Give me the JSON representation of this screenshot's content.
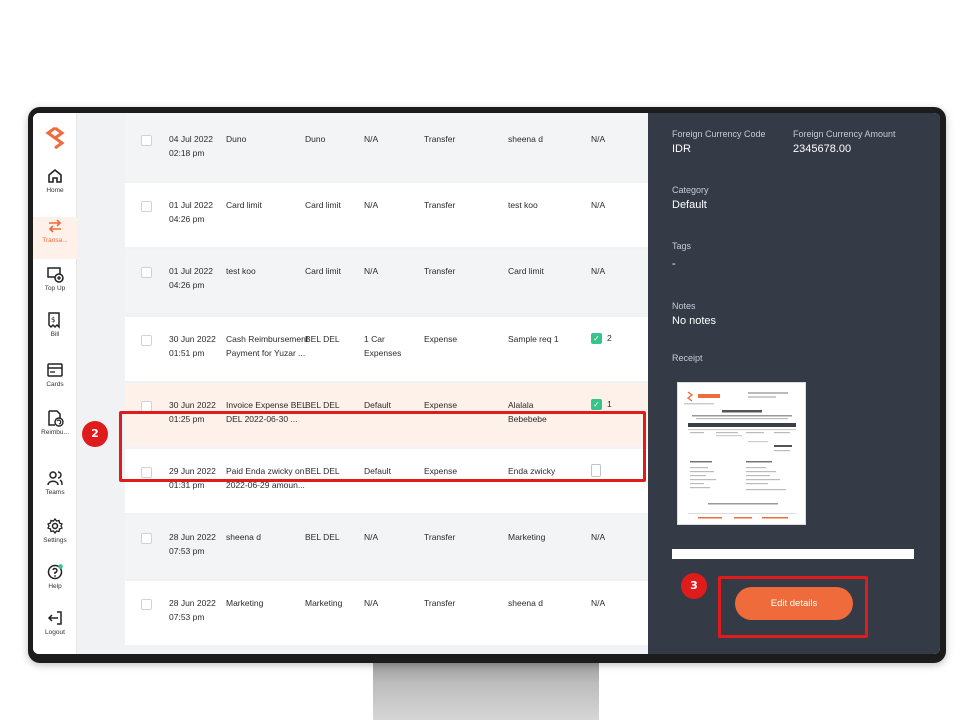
{
  "sidebar": {
    "items": [
      {
        "label": "Home",
        "icon": "home-icon"
      },
      {
        "label": "Transa...",
        "icon": "transfer-icon"
      },
      {
        "label": "Top Up",
        "icon": "top-up-icon"
      },
      {
        "label": "Bill",
        "icon": "bill-icon"
      },
      {
        "label": "Cards",
        "icon": "card-icon"
      },
      {
        "label": "Reimbu...",
        "icon": "reimburse-icon"
      },
      {
        "label": "Teams",
        "icon": "teams-icon"
      },
      {
        "label": "Settings",
        "icon": "settings-icon"
      },
      {
        "label": "Help",
        "icon": "help-icon"
      },
      {
        "label": "Logout",
        "icon": "logout-icon"
      }
    ]
  },
  "rows": [
    {
      "date": "04 Jul 2022",
      "time": "02:18 pm",
      "desc1": "Duno",
      "desc2": "",
      "team": "Duno",
      "category1": "N/A",
      "category2": "",
      "type": "Transfer",
      "person1": "sheena d",
      "person2": "",
      "receipt": "N/A"
    },
    {
      "date": "01 Jul 2022",
      "time": "04:26 pm",
      "desc1": "Card limit",
      "desc2": "",
      "team": "Card limit",
      "category1": "N/A",
      "category2": "",
      "type": "Transfer",
      "person1": "test koo",
      "person2": "",
      "receipt": "N/A"
    },
    {
      "date": "01 Jul 2022",
      "time": "04:26 pm",
      "desc1": "test koo",
      "desc2": "",
      "team": "Card limit",
      "category1": "N/A",
      "category2": "",
      "type": "Transfer",
      "person1": "Card limit",
      "person2": "",
      "receipt": "N/A"
    },
    {
      "date": "30 Jun 2022",
      "time": "01:51 pm",
      "desc1": "Cash Reimbursement",
      "desc2": "Payment for Yuzar ...",
      "team": "BEL DEL",
      "category1": "1 Car",
      "category2": "Expenses",
      "type": "Expense",
      "person1": "Sample req 1",
      "person2": "",
      "receipt": "2"
    },
    {
      "date": "30 Jun 2022",
      "time": "01:25 pm",
      "desc1": "Invoice Expense BEL",
      "desc2": "DEL 2022-06-30 ...",
      "team": "BEL DEL",
      "category1": "Default",
      "category2": "",
      "type": "Expense",
      "person1": "Alalala",
      "person2": "Bebebebe",
      "receipt": "1"
    },
    {
      "date": "29 Jun 2022",
      "time": "01:31 pm",
      "desc1": "Paid Enda zwicky on",
      "desc2": "2022-06-29 amoun...",
      "team": "BEL DEL",
      "category1": "Default",
      "category2": "",
      "type": "Expense",
      "person1": "Enda zwicky",
      "person2": "",
      "receipt": ""
    },
    {
      "date": "28 Jun 2022",
      "time": "07:53 pm",
      "desc1": "sheena d",
      "desc2": "",
      "team": "BEL DEL",
      "category1": "N/A",
      "category2": "",
      "type": "Transfer",
      "person1": "Marketing",
      "person2": "",
      "receipt": "N/A"
    },
    {
      "date": "28 Jun 2022",
      "time": "07:53 pm",
      "desc1": "Marketing",
      "desc2": "",
      "team": "Marketing",
      "category1": "N/A",
      "category2": "",
      "type": "Transfer",
      "person1": "sheena d",
      "person2": "",
      "receipt": "N/A"
    }
  ],
  "details": {
    "foreign_currency_code_label": "Foreign Currency Code",
    "foreign_currency_code": "IDR",
    "foreign_currency_amount_label": "Foreign Currency Amount",
    "foreign_currency_amount": "2345678.00",
    "category_label": "Category",
    "category": "Default",
    "tags_label": "Tags",
    "tags": "-",
    "notes_label": "Notes",
    "notes": "No notes",
    "receipt_label": "Receipt",
    "receipt_title": "Proof of Payment",
    "receipt_brand": "SPENMO",
    "edit_label": "Edit details"
  },
  "steps": {
    "two": "2",
    "three": "3"
  },
  "colors": {
    "accent": "#ef6b3b",
    "highlight": "#e01b1b",
    "panel": "#343a46",
    "success": "#36c48c"
  }
}
